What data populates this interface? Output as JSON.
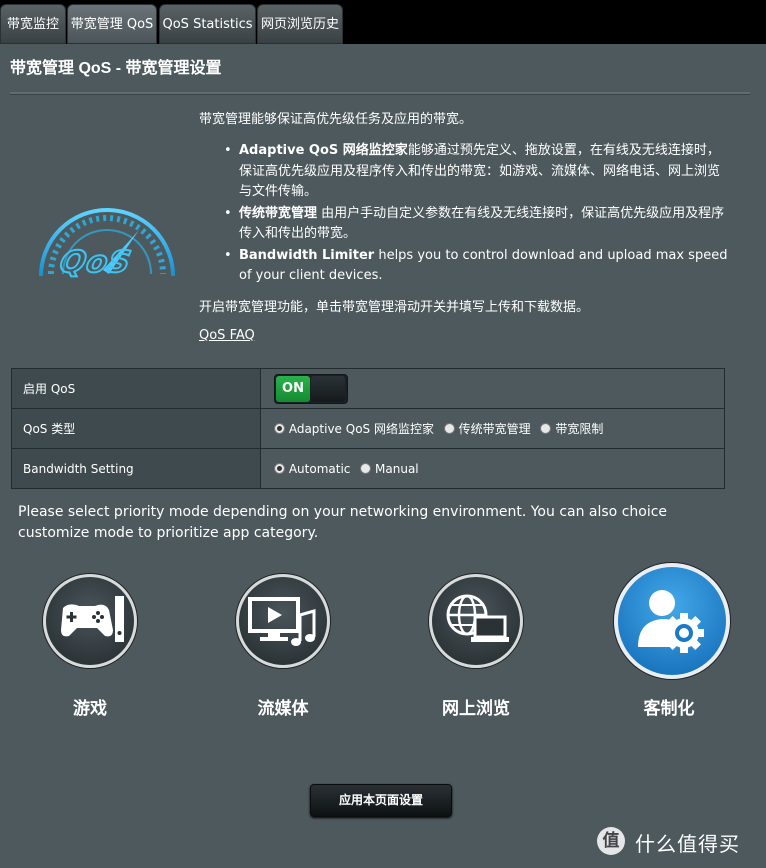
{
  "tabs": [
    {
      "label": "带宽监控"
    },
    {
      "label": "带宽管理 QoS"
    },
    {
      "label": "QoS Statistics"
    },
    {
      "label": "网页浏览历史"
    }
  ],
  "page": {
    "title": "带宽管理 QoS - 带宽管理设置",
    "intro": "带宽管理能够保证高优先级任务及应用的带宽。",
    "bullets": [
      {
        "bold": "Adaptive QoS 网络监控家",
        "text": "能够通过预先定义、拖放设置，在有线及无线连接时，保证高优先级应用及程序传入和传出的带宽：如游戏、流媒体、网络电话、网上浏览与文件传输。"
      },
      {
        "bold": "传统带宽管理",
        "text": " 由用户手动自定义参数在有线及无线连接时，保证高优先级应用及程序传入和传出的带宽。"
      },
      {
        "bold": "Bandwidth Limiter",
        "text": " helps you to control download and upload max speed of your client devices."
      }
    ],
    "enable_note": "开启带宽管理功能，单击带宽管理滑动开关并填写上传和下载数据。",
    "faq_link": "QoS FAQ",
    "logo_text": "QoS"
  },
  "settings": {
    "enable_qos": {
      "label": "启用 QoS",
      "value": "ON"
    },
    "qos_type": {
      "label": "QoS 类型",
      "options": [
        "Adaptive QoS 网络监控家",
        "传统带宽管理",
        "带宽限制"
      ],
      "selected": "Adaptive QoS 网络监控家"
    },
    "bandwidth_setting": {
      "label": "Bandwidth Setting",
      "options": [
        "Automatic",
        "Manual"
      ],
      "selected": "Automatic"
    }
  },
  "priority_description": "Please select priority mode depending on your networking environment. You can also choice customize mode to prioritize app category.",
  "modes": [
    {
      "label": "游戏",
      "icon": "gamepad-icon"
    },
    {
      "label": "流媒体",
      "icon": "media-streaming-icon"
    },
    {
      "label": "网上浏览",
      "icon": "web-browsing-icon"
    },
    {
      "label": "客制化",
      "icon": "customize-user-gear-icon",
      "selected": true
    }
  ],
  "apply_button": "应用本页面设置",
  "watermark": {
    "badge": "值",
    "text": "什么值得买"
  },
  "colors": {
    "panel_bg": "#4d595d",
    "on_green": "#1fa040",
    "selected_mode": "#1a7ac8",
    "logo_cyan": "#2ab4e8"
  }
}
